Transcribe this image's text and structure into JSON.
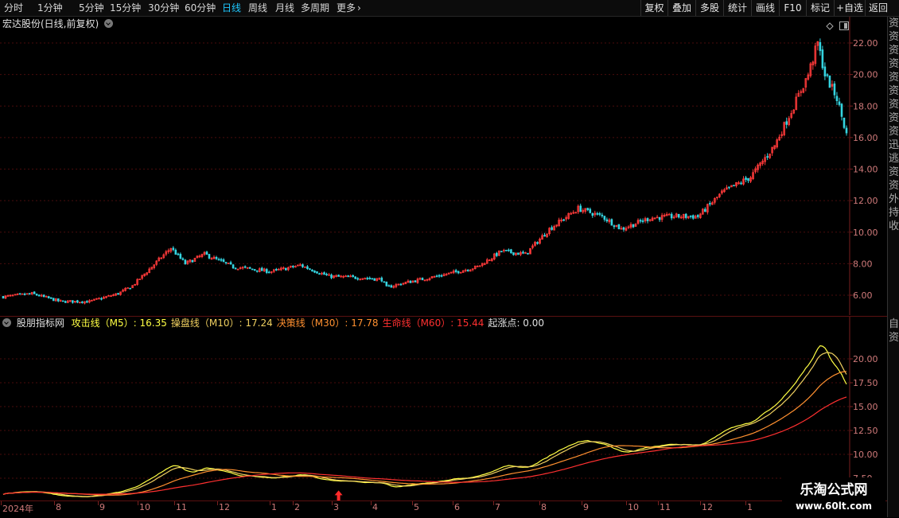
{
  "toolbar": {
    "periods": [
      "分时",
      "1分钟",
      "5分钟",
      "15分钟",
      "30分钟",
      "60分钟",
      "日线",
      "周线",
      "月线",
      "多周期",
      "更多"
    ],
    "active_period": "日线",
    "more_arrow": "chevron-right-icon",
    "right_buttons": [
      "复权",
      "叠加",
      "多股",
      "统计",
      "画线",
      "F10",
      "标记",
      "+自选",
      "返回"
    ]
  },
  "main_panel": {
    "title": "宏达股份(日线,前复权)",
    "dropdown_icon": "chevron-down-icon",
    "corner_icons": [
      "diamond-icon",
      "panel-toggle-icon"
    ],
    "y_ticks": [
      "22.00",
      "20.00",
      "18.00",
      "16.00",
      "14.00",
      "12.00",
      "10.00",
      "8.00",
      "6.00"
    ]
  },
  "indicator_panel": {
    "name": "股朋指标网",
    "lines": [
      {
        "label": "攻击线（M5）",
        "value": ": 16.35",
        "color": "#ffff44"
      },
      {
        "label": "操盘线（M10）",
        "value": ": 17.24",
        "color": "#f0d060"
      },
      {
        "label": "决策线（M30）",
        "value": ": 17.78",
        "color": "#ff9030"
      },
      {
        "label": "生命线（M60）",
        "value": ": 15.44",
        "color": "#ff3030"
      },
      {
        "label": "起涨点",
        "value": ": 0.00",
        "color": "#e0e0e0"
      }
    ],
    "y_ticks": [
      "20.00",
      "17.50",
      "15.00",
      "12.50",
      "10.00",
      "7.50"
    ]
  },
  "date_axis": {
    "labels": [
      "2024年",
      "8",
      "9",
      "10",
      "11",
      "12",
      "1",
      "2",
      "3",
      "4",
      "5",
      "6",
      "7",
      "8",
      "9",
      "10",
      "11",
      "12",
      "1"
    ]
  },
  "right_strip": {
    "top_text": "资资资资资资资资资迅逃资资外持收",
    "bottom_text": "自资"
  },
  "watermark": {
    "line1": "乐淘公式网",
    "line2": "www.60lt.com"
  },
  "colors": {
    "up": "#ff3a3a",
    "down": "#35d4e0",
    "active_period": "#1ec8ff",
    "axis_label": "#d07a7a",
    "grid": "#4a0c0c"
  },
  "chart_data": {
    "type": "candlestick",
    "ylim": [
      5.0,
      23.0
    ],
    "close_anchors": [
      [
        0,
        5.9
      ],
      [
        12,
        6.1
      ],
      [
        24,
        5.6
      ],
      [
        36,
        5.6
      ],
      [
        48,
        6.1
      ],
      [
        54,
        6.6
      ],
      [
        58,
        7.2
      ],
      [
        64,
        8.1
      ],
      [
        70,
        9.0
      ],
      [
        76,
        8.0
      ],
      [
        84,
        8.6
      ],
      [
        96,
        7.8
      ],
      [
        112,
        7.5
      ],
      [
        124,
        7.9
      ],
      [
        136,
        7.2
      ],
      [
        150,
        7.1
      ],
      [
        158,
        7.0
      ],
      [
        160,
        6.5
      ],
      [
        168,
        6.8
      ],
      [
        184,
        7.3
      ],
      [
        198,
        7.8
      ],
      [
        208,
        8.8
      ],
      [
        218,
        8.6
      ],
      [
        228,
        10.2
      ],
      [
        240,
        11.5
      ],
      [
        250,
        11.0
      ],
      [
        258,
        10.2
      ],
      [
        270,
        10.9
      ],
      [
        280,
        11.0
      ],
      [
        290,
        11.0
      ],
      [
        300,
        12.5
      ],
      [
        312,
        13.5
      ],
      [
        322,
        15.5
      ],
      [
        330,
        18.0
      ],
      [
        336,
        20.0
      ],
      [
        340,
        22.0
      ],
      [
        343,
        20.0
      ],
      [
        348,
        18.5
      ],
      [
        352,
        16.2
      ]
    ],
    "ma_lines": [
      {
        "name": "攻击线（M5）",
        "last": 16.35
      },
      {
        "name": "操盘线（M10）",
        "last": 17.24
      },
      {
        "name": "决策线（M30）",
        "last": 17.78
      },
      {
        "name": "生命线（M60）",
        "last": 15.44
      }
    ],
    "indicator_ylim": [
      6.5,
      22.0
    ],
    "signal_marker": {
      "label": "起涨点",
      "position_index": 140
    }
  }
}
